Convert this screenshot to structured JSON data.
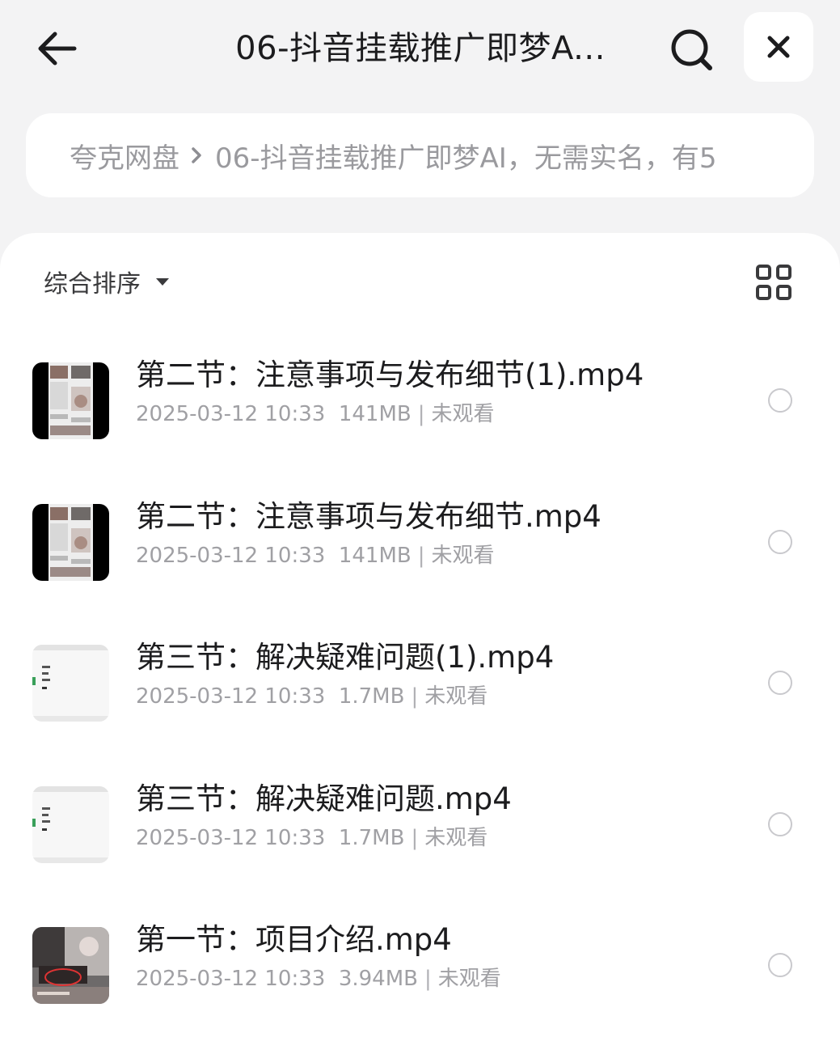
{
  "header": {
    "title": "06-抖音挂载推广即梦A...",
    "back_icon": "arrow-left-icon",
    "search_icon": "search-icon",
    "close_icon": "close-icon"
  },
  "breadcrumb": {
    "root": "夸克网盘",
    "current": "06-抖音挂载推广即梦AI，无需实名，有5"
  },
  "toolbar": {
    "sort_label": "综合排序",
    "grid_icon": "grid-view-icon"
  },
  "files": [
    {
      "name": "第二节：注意事项与发布细节(1).mp4",
      "date": "2025-03-12 10:33",
      "size": "141MB",
      "status": "未观看",
      "thumb": "dark"
    },
    {
      "name": "第二节：注意事项与发布细节.mp4",
      "date": "2025-03-12 10:33",
      "size": "141MB",
      "status": "未观看",
      "thumb": "dark"
    },
    {
      "name": "第三节：解决疑难问题(1).mp4",
      "date": "2025-03-12 10:33",
      "size": "1.7MB",
      "status": "未观看",
      "thumb": "light"
    },
    {
      "name": "第三节：解决疑难问题.mp4",
      "date": "2025-03-12 10:33",
      "size": "1.7MB",
      "status": "未观看",
      "thumb": "light"
    },
    {
      "name": "第一节：项目介绍.mp4",
      "date": "2025-03-12 10:33",
      "size": "3.94MB",
      "status": "未观看",
      "thumb": "photo"
    }
  ]
}
